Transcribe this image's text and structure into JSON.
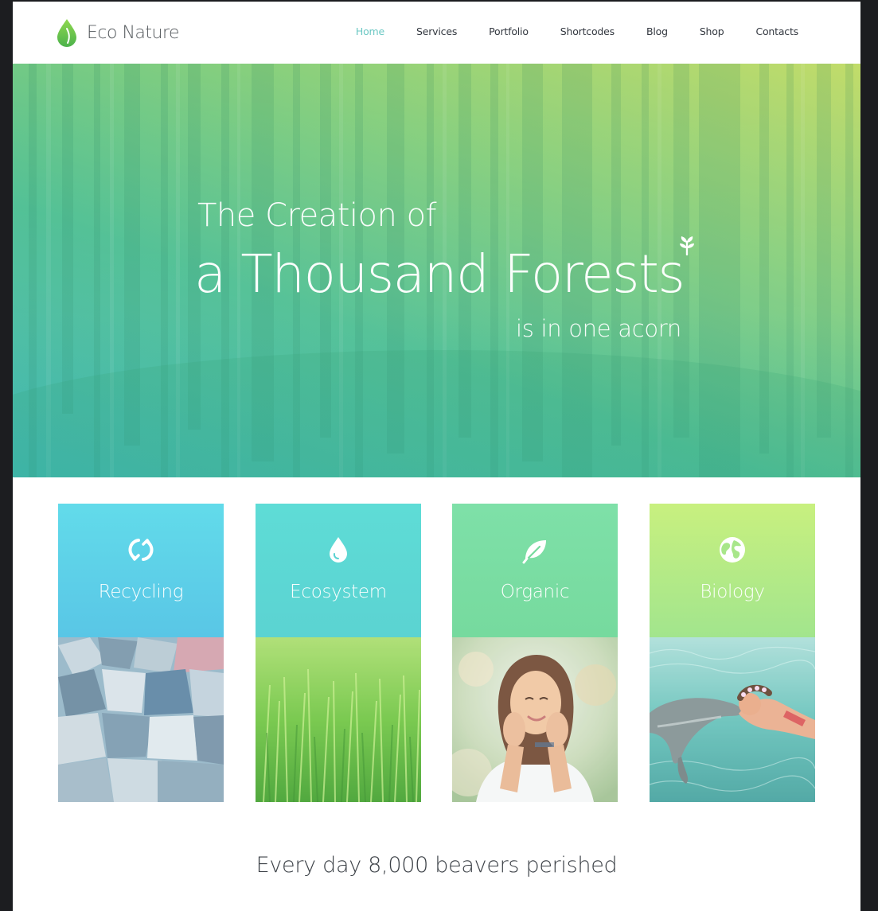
{
  "brand": {
    "name": "Eco Nature",
    "accent": "#6cc8c4",
    "logo_icon": "leaf-drop-icon"
  },
  "nav": {
    "items": [
      {
        "label": "Home",
        "active": true
      },
      {
        "label": "Services",
        "active": false
      },
      {
        "label": "Portfolio",
        "active": false
      },
      {
        "label": "Shortcodes",
        "active": false
      },
      {
        "label": "Blog",
        "active": false
      },
      {
        "label": "Shop",
        "active": false
      },
      {
        "label": "Contacts",
        "active": false
      }
    ]
  },
  "hero": {
    "line1": "The Creation of",
    "line2": "a Thousand Forests",
    "line3": "is in one acorn",
    "badge_icon": "sprout-icon",
    "colors": {
      "top_right": "#c2dc6a",
      "bottom_left": "#3db6b0"
    }
  },
  "cards": [
    {
      "title": "Recycling",
      "icon": "recycle-icon",
      "color": "#5fd3e6",
      "image": "crushed-cans-photo"
    },
    {
      "title": "Ecosystem",
      "icon": "water-drop-icon",
      "color": "#5dd8cc",
      "image": "green-grass-photo"
    },
    {
      "title": "Organic",
      "icon": "leaf-icon",
      "color": "#79dca4",
      "image": "smiling-girl-photo"
    },
    {
      "title": "Biology",
      "icon": "globe-icon",
      "color": "#b5eb86",
      "image": "dolphin-swimmer-photo"
    }
  ],
  "tagline": "Every day 8,000 beavers perished"
}
